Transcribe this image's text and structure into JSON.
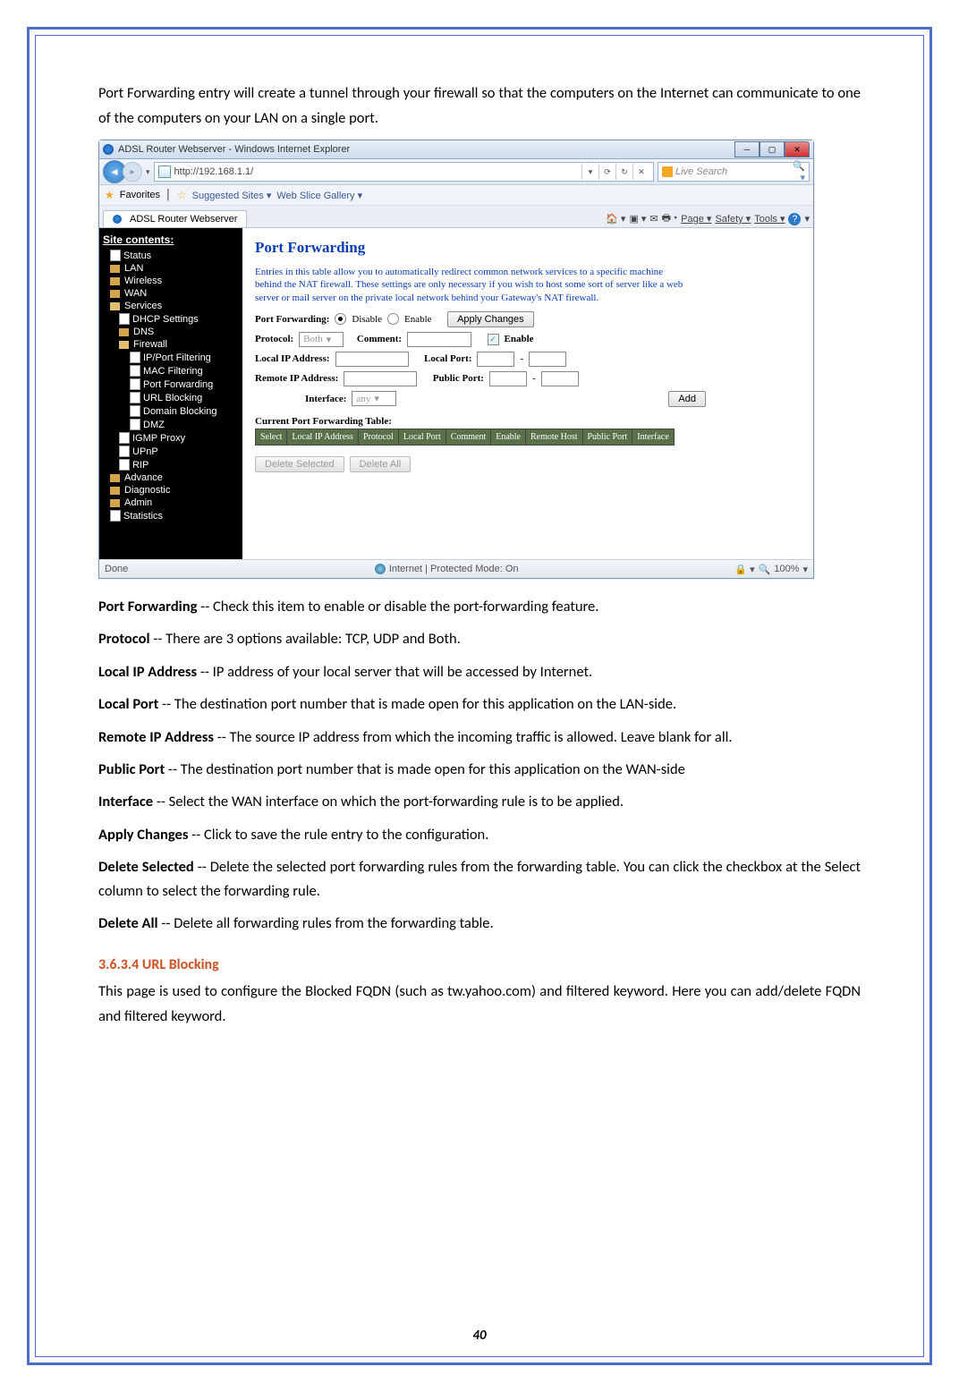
{
  "intro": "Port Forwarding entry will create a tunnel through your firewall so that the computers on the Internet can communicate to one of the computers on your LAN on a single port.",
  "window": {
    "title": "ADSL Router Webserver - Windows Internet Explorer",
    "url": "http://192.168.1.1/",
    "search_placeholder": "Live Search",
    "favorites_label": "Favorites",
    "suggested": "Suggested Sites ▾",
    "webslice": "Web Slice Gallery ▾",
    "tab_label": "ADSL Router Webserver",
    "cmd": {
      "page": "Page ▾",
      "safety": "Safety ▾",
      "tools": "Tools ▾"
    },
    "status_done": "Done",
    "status_mode": "Internet | Protected Mode: On",
    "zoom": "100%"
  },
  "sidebar": {
    "title": "Site contents:",
    "items": [
      "Status",
      "LAN",
      "Wireless",
      "WAN",
      "Services",
      "DHCP Settings",
      "DNS",
      "Firewall",
      "IP/Port Filtering",
      "MAC Filtering",
      "Port Forwarding",
      "URL Blocking",
      "Domain Blocking",
      "DMZ",
      "IGMP Proxy",
      "UPnP",
      "RIP",
      "Advance",
      "Diagnostic",
      "Admin",
      "Statistics"
    ]
  },
  "panel": {
    "title": "Port Forwarding",
    "desc": "Entries in this table allow you to automatically redirect common network services to a specific machine behind the NAT firewall. These settings are only necessary if you wish to host some sort of server like a web server or mail server on the private local network behind your Gateway's NAT firewall.",
    "pf_label": "Port Forwarding:",
    "disable": "Disable",
    "enable": "Enable",
    "apply": "Apply Changes",
    "protocol": "Protocol:",
    "protocol_val": "Both",
    "comment": "Comment:",
    "enable_chk": "Enable",
    "local_ip": "Local IP Address:",
    "local_port": "Local Port:",
    "remote_ip": "Remote IP Address:",
    "public_port": "Public Port:",
    "interface": "Interface:",
    "interface_val": "any",
    "add": "Add",
    "table_title": "Current Port Forwarding Table:",
    "th": [
      "Select",
      "Local IP Address",
      "Protocol",
      "Local Port",
      "Comment",
      "Enable",
      "Remote Host",
      "Public Port",
      "Interface"
    ],
    "delete_selected": "Delete Selected",
    "delete_all": "Delete All"
  },
  "definitions": [
    {
      "term": "Port Forwarding",
      "desc": " -- Check this item to enable or disable the port-forwarding feature."
    },
    {
      "term": "Protocol",
      "desc": " -- There are 3 options available: TCP, UDP and Both."
    },
    {
      "term": "Local IP Address",
      "desc": " -- IP address of your local server that will be accessed by Internet."
    },
    {
      "term": "Local Port",
      "desc": " -- The destination port number that is made open for this application on the LAN-side."
    },
    {
      "term": "Remote IP Address",
      "desc": " -- The source IP address from which the incoming traffic is allowed. Leave blank for all."
    },
    {
      "term": "Public Port",
      "desc": " -- The destination port number that is made open for this application on the WAN-side"
    },
    {
      "term": "Interface",
      "desc": " -- Select the WAN interface on which the port-forwarding rule is to be applied."
    },
    {
      "term": "Apply Changes",
      "desc": " -- Click to save the rule entry to the configuration."
    },
    {
      "term": "Delete Selected",
      "desc": " -- Delete the selected port forwarding rules from the forwarding table. You can click the checkbox at the Select column to select the forwarding rule."
    },
    {
      "term": "Delete All",
      "desc": " -- Delete all forwarding rules from the forwarding table."
    }
  ],
  "section": {
    "heading": "3.6.3.4 URL Blocking",
    "body": "This page is used to configure the Blocked FQDN (such as tw.yahoo.com) and filtered keyword. Here you can add/delete FQDN and filtered keyword."
  },
  "page_number": "40"
}
